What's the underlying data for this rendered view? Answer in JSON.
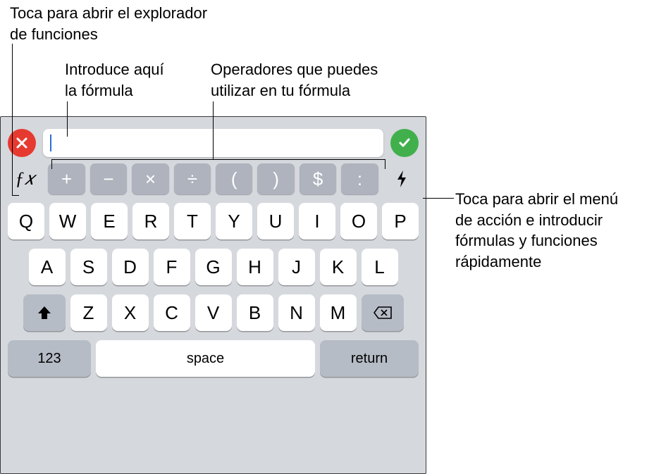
{
  "callouts": {
    "fx": "Toca para abrir el explorador\nde funciones",
    "input": "Introduce aquí\nla fórmula",
    "ops": "Operadores que puedes\nutilizar en tu fórmula",
    "bolt": "Toca para abrir el menú de acción e introducir fórmulas y funciones rápidamente"
  },
  "formula_bar": {
    "value": ""
  },
  "operators": [
    "+",
    "−",
    "×",
    "÷",
    "(",
    ")",
    "$",
    ":"
  ],
  "fx_label": "ƒ𝑥",
  "keyboard": {
    "row1": [
      "Q",
      "W",
      "E",
      "R",
      "T",
      "Y",
      "U",
      "I",
      "O",
      "P"
    ],
    "row2": [
      "A",
      "S",
      "D",
      "F",
      "G",
      "H",
      "J",
      "K",
      "L"
    ],
    "row3": [
      "Z",
      "X",
      "C",
      "V",
      "B",
      "N",
      "M"
    ],
    "num_label": "123",
    "space_label": "space",
    "return_label": "return"
  }
}
